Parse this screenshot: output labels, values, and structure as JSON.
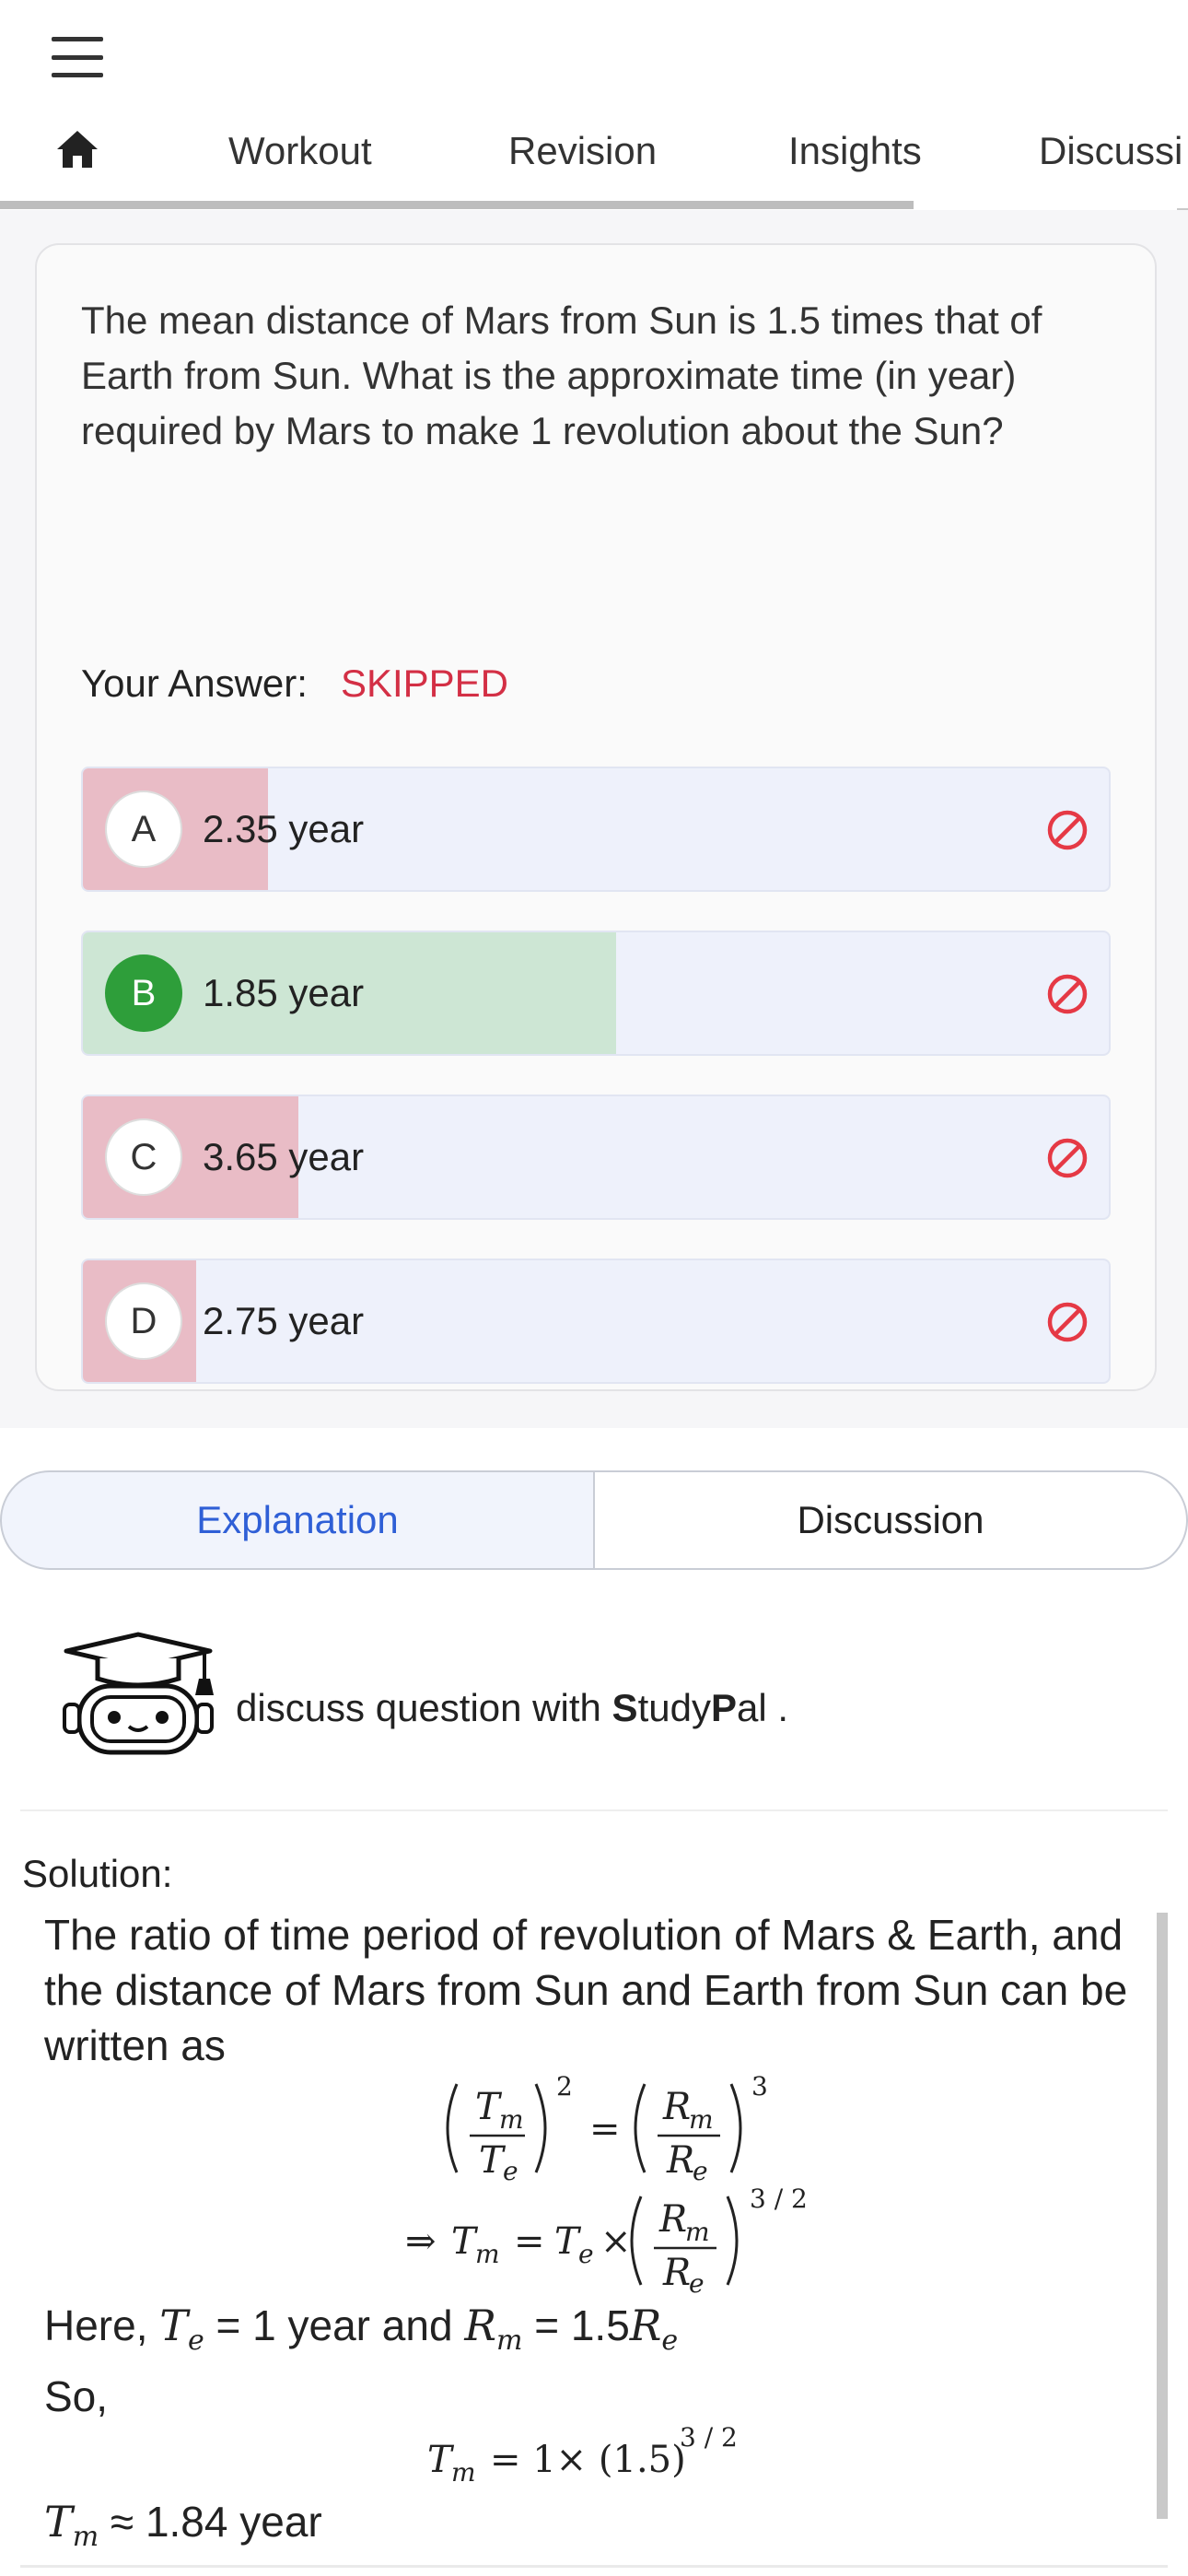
{
  "header": {
    "tabs": [
      {
        "label": "Workout"
      },
      {
        "label": "Revision"
      },
      {
        "label": "Insights"
      },
      {
        "label": "Discussi"
      }
    ]
  },
  "question": {
    "text": "The mean distance of Mars from Sun is 1.5 times that of Earth from Sun. What is the approximate time (in year) required by Mars to make 1 revolution about the Sun?",
    "your_answer_label": "Your Answer:",
    "your_answer_value": "SKIPPED",
    "options": [
      {
        "letter": "A",
        "text": "2.35 year",
        "fill_fraction": 0.18,
        "state": "incorrect"
      },
      {
        "letter": "B",
        "text": "1.85 year",
        "fill_fraction": 0.52,
        "state": "correct"
      },
      {
        "letter": "C",
        "text": "3.65 year",
        "fill_fraction": 0.21,
        "state": "incorrect"
      },
      {
        "letter": "D",
        "text": "2.75 year",
        "fill_fraction": 0.11,
        "state": "incorrect"
      }
    ]
  },
  "colors": {
    "skipped": "#d32f45",
    "correct_fill": "#cde6d4",
    "incorrect_fill": "#e9bcc6",
    "correct_badge": "#2e9e3a",
    "accent": "#2f5fd6"
  },
  "lower_tabs": {
    "explanation": "Explanation",
    "discussion": "Discussion"
  },
  "studypal": {
    "prefix": "discuss question with ",
    "s_bold": "S",
    "s_rest": "tudy",
    "p_bold": "P",
    "p_rest": "al ."
  },
  "solution": {
    "title": "Solution:",
    "intro": "The ratio of time period of revolution of Mars & Earth, and the distance of Mars from Sun and Earth from Sun can be written as",
    "here": "Here,",
    "t_e": "T",
    "year_and": "= 1 year and",
    "r_m_eq": "= 1.5",
    "so": "So,",
    "final": "≈ 1.84 year"
  },
  "icons": [
    "menu-icon",
    "home-icon",
    "ban-icon",
    "robot-graduate-icon"
  ]
}
